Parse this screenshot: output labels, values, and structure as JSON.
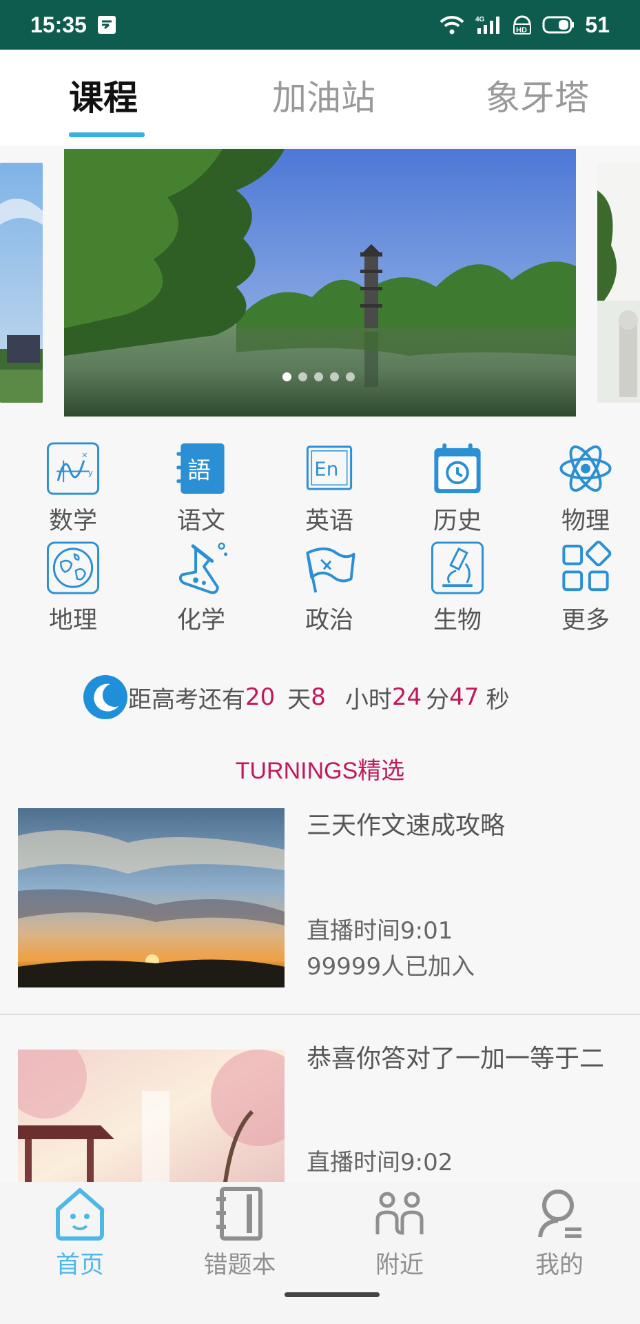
{
  "status_bar": {
    "time": "15:35",
    "network": "4G",
    "hd": "HD",
    "battery": "51",
    "icons": [
      "notification-icon",
      "wifi-icon",
      "signal-icon",
      "hd-icon",
      "battery-icon"
    ]
  },
  "top_tabs": [
    {
      "label": "课程",
      "active": true
    },
    {
      "label": "加油站",
      "active": false
    },
    {
      "label": "象牙塔",
      "active": false
    }
  ],
  "banner": {
    "dot_count": 5,
    "active_index": 0
  },
  "subjects": [
    {
      "label": "数学",
      "icon": "math-icon"
    },
    {
      "label": "语文",
      "icon": "chinese-icon",
      "glyph": "語"
    },
    {
      "label": "英语",
      "icon": "english-icon",
      "glyph": "En"
    },
    {
      "label": "历史",
      "icon": "history-icon"
    },
    {
      "label": "物理",
      "icon": "physics-icon"
    },
    {
      "label": "地理",
      "icon": "geography-icon"
    },
    {
      "label": "化学",
      "icon": "chemistry-icon"
    },
    {
      "label": "政治",
      "icon": "politics-icon"
    },
    {
      "label": "生物",
      "icon": "biology-icon"
    },
    {
      "label": "更多",
      "icon": "more-icon"
    }
  ],
  "countdown": {
    "prefix": "距高考还有",
    "days": "20",
    "days_unit": "天",
    "hours": "8",
    "hours_unit": "小时",
    "minutes": "24",
    "minutes_unit": "分",
    "seconds": "47",
    "seconds_unit": "秒"
  },
  "section_title": "TURNINGS精选",
  "courses": [
    {
      "title": "三天作文速成攻略",
      "time": "直播时间9:01",
      "people": "99999人已加入"
    },
    {
      "title": "恭喜你答对了一加一等于二",
      "time": "直播时间9:02",
      "people": ""
    }
  ],
  "bottom_nav": [
    {
      "label": "首页",
      "icon": "home-icon",
      "active": true
    },
    {
      "label": "错题本",
      "icon": "notebook-icon",
      "active": false
    },
    {
      "label": "附近",
      "icon": "nearby-icon",
      "active": false
    },
    {
      "label": "我的",
      "icon": "profile-icon",
      "active": false
    }
  ],
  "colors": {
    "status_bar": "#0d5c4d",
    "accent": "#3ab0e0",
    "highlight": "#c2185b",
    "nav_active": "#4fb7e8"
  }
}
